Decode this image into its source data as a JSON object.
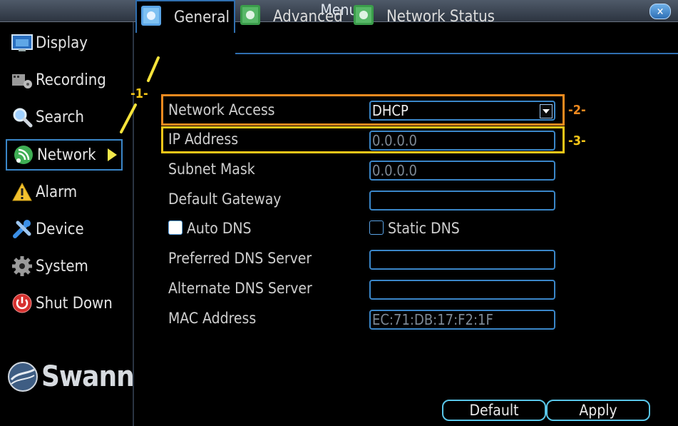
{
  "window": {
    "title": "Menu"
  },
  "sidebar": {
    "items": [
      {
        "label": "Display",
        "icon": "display-icon"
      },
      {
        "label": "Recording",
        "icon": "recording-icon"
      },
      {
        "label": "Search",
        "icon": "search-icon"
      },
      {
        "label": "Network",
        "icon": "network-icon",
        "active": true
      },
      {
        "label": "Alarm",
        "icon": "alarm-icon"
      },
      {
        "label": "Device",
        "icon": "device-icon"
      },
      {
        "label": "System",
        "icon": "system-icon"
      },
      {
        "label": "Shut Down",
        "icon": "shutdown-icon"
      }
    ],
    "logo_text": "Swann"
  },
  "tabs": [
    {
      "label": "General",
      "active": true
    },
    {
      "label": "Advanced"
    },
    {
      "label": "Network Status"
    }
  ],
  "form": {
    "network_access": {
      "label": "Network Access",
      "value": "DHCP"
    },
    "ip_address": {
      "label": "IP Address",
      "value": "0.0.0.0"
    },
    "subnet_mask": {
      "label": "Subnet Mask",
      "value": "0.0.0.0"
    },
    "default_gateway": {
      "label": "Default Gateway",
      "value": ""
    },
    "auto_dns": {
      "label": "Auto DNS",
      "checked": true
    },
    "static_dns": {
      "label": "Static DNS",
      "checked": false
    },
    "preferred_dns": {
      "label": "Preferred DNS Server",
      "value": ""
    },
    "alternate_dns": {
      "label": "Alternate DNS Server",
      "value": ""
    },
    "mac_address": {
      "label": "MAC Address",
      "value": "EC:71:DB:17:F2:1F"
    }
  },
  "annotations": {
    "one": "-1-",
    "two": "-2-",
    "three": "-3-"
  },
  "buttons": {
    "default": "Default",
    "apply": "Apply"
  },
  "colors": {
    "accent": "#3a86c8",
    "anno_orange": "#f08a1f",
    "anno_yellow": "#f5c618"
  }
}
